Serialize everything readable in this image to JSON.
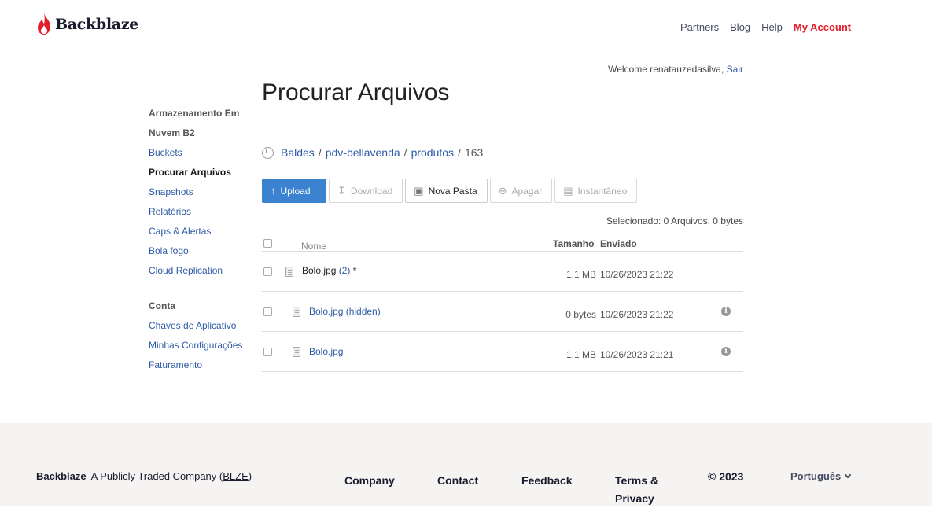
{
  "header": {
    "logo": "Backblaze",
    "nav": [
      "Partners",
      "Blog",
      "Help"
    ],
    "account": "My Account",
    "accent_color": "#e21e29"
  },
  "welcome": {
    "text": "Welcome renatauzedasilva,",
    "logout": "Sair"
  },
  "sidebar": {
    "storage_title": "Armazenamento Em Nuvem B2",
    "storage_items": [
      {
        "label": "Buckets"
      },
      {
        "label": "Procurar Arquivos",
        "active": true
      },
      {
        "label": "Snapshots"
      },
      {
        "label": "Relatórios"
      },
      {
        "label": "Caps & Alertas"
      },
      {
        "label": "Bola fogo"
      },
      {
        "label": "Cloud Replication"
      }
    ],
    "account_title": "Conta",
    "account_items": [
      {
        "label": "Chaves de Aplicativo"
      },
      {
        "label": "Minhas Configurações"
      },
      {
        "label": "Faturamento"
      }
    ]
  },
  "main": {
    "title": "Procurar Arquivos",
    "breadcrumb": [
      "Baldes",
      "pdv-bellavenda",
      "produtos"
    ],
    "breadcrumb_current": "163",
    "toolbar": {
      "upload": "Upload",
      "download": "Download",
      "new_folder": "Nova Pasta",
      "delete": "Apagar",
      "snapshot": "Instantâneo"
    },
    "selection": "Selecionado: 0 Arquivos: 0 bytes",
    "table": {
      "headers": {
        "name": "Nome",
        "size": "Tamanho",
        "date": "Enviado"
      },
      "rows": [
        {
          "name": "Bolo.jpg",
          "versions": "(2)",
          "marker": "*",
          "size": "1.1 MB",
          "date": "10/26/2023 21:22",
          "info": false
        },
        {
          "name": "Bolo.jpg (hidden)",
          "size": "0 bytes",
          "date": "10/26/2023 21:22",
          "info": true
        },
        {
          "name": "Bolo.jpg",
          "size": "1.1 MB",
          "date": "10/26/2023 21:21",
          "info": true
        }
      ]
    }
  },
  "footer": {
    "brand": "Backblaze",
    "tagline": "A Publicly Traded Company (",
    "ticker": "BLZE",
    "tagline_end": ")",
    "links": [
      "Company",
      "Contact",
      "Feedback",
      "Terms & Privacy"
    ],
    "copyright": "© 2023",
    "language": "Português"
  }
}
